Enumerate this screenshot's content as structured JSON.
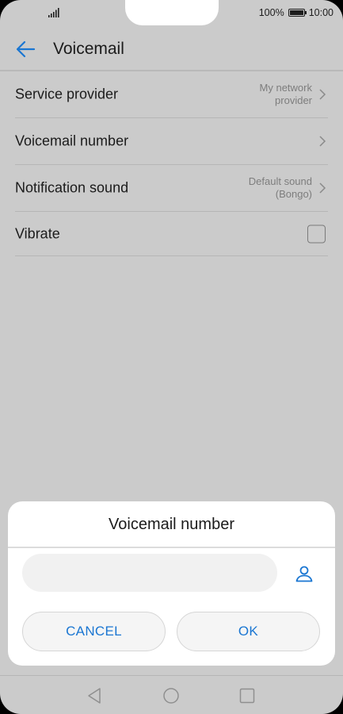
{
  "status_bar": {
    "battery": "100%",
    "time": "10:00",
    "icons": [
      "signal-icon",
      "battery-icon"
    ]
  },
  "app_bar": {
    "title": "Voicemail",
    "back_icon": "back-arrow-icon"
  },
  "settings": [
    {
      "label": "Service provider",
      "value_line1": "My network",
      "value_line2": "provider",
      "control": "chevron-right-icon"
    },
    {
      "label": "Voicemail number",
      "value_line1": "",
      "value_line2": "",
      "control": "chevron-right-icon"
    },
    {
      "label": "Notification sound",
      "value_line1": "Default sound",
      "value_line2": "(Bongo)",
      "control": "chevron-right-icon"
    },
    {
      "label": "Vibrate",
      "control": "checkbox",
      "checked": false
    }
  ],
  "dialog": {
    "title": "Voicemail number",
    "input_value": "",
    "contact_icon": "contact-icon",
    "cancel_label": "CANCEL",
    "ok_label": "OK"
  },
  "colors": {
    "accent": "#1a76d2",
    "dim_background": "#cbcbcb"
  },
  "nav_bar": {
    "icons": [
      "nav-back-icon",
      "nav-home-icon",
      "nav-recent-icon"
    ]
  }
}
